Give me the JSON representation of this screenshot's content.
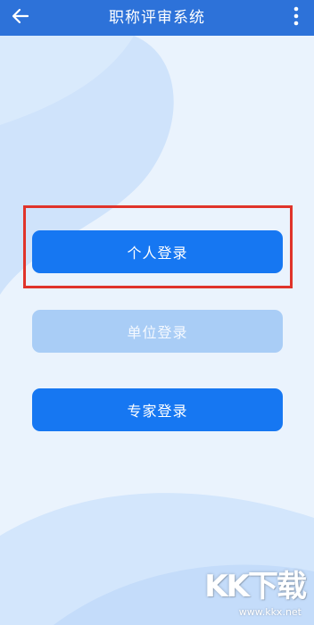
{
  "header": {
    "title": "职称评审系统",
    "back_icon": "arrow-left-icon",
    "more_icon": "more-vertical-icon"
  },
  "buttons": {
    "personal_login": "个人登录",
    "unit_login": "单位登录",
    "expert_login": "专家登录"
  },
  "watermark": {
    "logo_text": "KK下载",
    "url": "www.kkx.net"
  },
  "colors": {
    "header": "#2d72d9",
    "primary_button": "#1677f2",
    "disabled_button": "#a9cdf6",
    "highlight": "#e0342a",
    "background": "#eaf3fd"
  }
}
